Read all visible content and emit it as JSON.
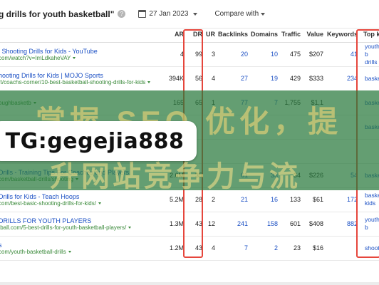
{
  "header": {
    "query": "g drills for youth basketball\"",
    "help_glyph": "?",
    "date": "27 Jan 2023",
    "compare_label": "Compare with"
  },
  "columns": [
    "AR",
    "DR",
    "UR",
    "Backlinks",
    "Domains",
    "Traffic",
    "Value",
    "Keywords",
    "Top keyw"
  ],
  "rows": [
    {
      "title": "l Shooting Drills for Kids - YouTube",
      "url": "com/watch?v=ImLdkaheVAY",
      "ar": "4",
      "dr": "99",
      "ur": "3",
      "backlinks": "20",
      "domains": "10",
      "traffic": "475",
      "value": "$207",
      "keywords": "41",
      "top_keyword": "youth b drills"
    },
    {
      "title": "hooting Drills for Kids | MOJO Sports",
      "url": "rt/coachs-corner/10-best-basketball-shooting-drills-for-kids",
      "ar": "394K",
      "dr": "56",
      "ur": "4",
      "backlinks": "27",
      "domains": "19",
      "traffic": "429",
      "value": "$333",
      "keywords": "234",
      "top_keyword": "basketb"
    },
    {
      "title": "",
      "url": "oughbasketb",
      "ar": "165",
      "dr": "65",
      "ur": "1",
      "backlinks": "77",
      "domains": "7",
      "traffic": "1,755",
      "value": "$1,1",
      "keywords": "",
      "top_keyword": "basketb"
    },
    {
      "title": "",
      "url": "",
      "ar": "",
      "dr": "",
      "ur": "",
      "backlinks": "",
      "domains": "",
      "traffic": "",
      "value": "",
      "keywords": "",
      "top_keyword": "basketb"
    },
    {
      "title": "",
      "url": "ng.com/10-fun-",
      "ar": "",
      "dr": "",
      "ur": "",
      "backlinks": "",
      "domains": "",
      "traffic": "",
      "value": "",
      "keywords": "",
      "top_keyword": ""
    },
    {
      "title": "Drills - Training Tips For Coaches and Players",
      "url": "com/basketball-drills/shooting",
      "ar": "2.6M",
      "dr": "35",
      "ur": "",
      "backlinks": "61",
      "domains": "33",
      "traffic": "34",
      "value": "$226",
      "keywords": "54",
      "top_keyword": "basketb"
    },
    {
      "title": "Drills for Kids - Teach Hoops",
      "url": "com/best-basic-shooting-drills-for-kids/",
      "ar": "5.2M",
      "dr": "28",
      "ur": "2",
      "backlinks": "21",
      "domains": "16",
      "traffic": "133",
      "value": "$61",
      "keywords": "172",
      "top_keyword": "basketb kids"
    },
    {
      "title": "DRILLS FOR YOUTH PLAYERS",
      "url": "tball.com/5-best-drills-for-youth-basketball-players/",
      "ar": "1.3M",
      "dr": "43",
      "ur": "12",
      "backlinks": "241",
      "domains": "158",
      "traffic": "601",
      "value": "$408",
      "keywords": "882",
      "top_keyword": "youth b"
    },
    {
      "title": "s",
      "url": "com/youth-basketball-drills",
      "ar": "1.2M",
      "dr": "43",
      "ur": "4",
      "backlinks": "7",
      "domains": "2",
      "traffic": "23",
      "value": "$16",
      "keywords": "",
      "top_keyword": "shootin"
    }
  ],
  "watermark": {
    "line1": "掌握 SEO 优化，提",
    "line2": "升网站竞争力与流",
    "contact": "TG:gegejia888"
  }
}
